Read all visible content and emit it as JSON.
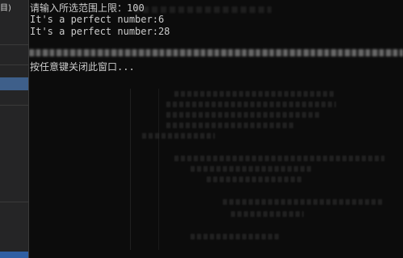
{
  "sidebar": {
    "label": "目)"
  },
  "console": {
    "lines": [
      "请输入所选范围上限：100",
      "It's a perfect number:6",
      "It's a perfect number:28"
    ],
    "exit_prompt": "按任意键关闭此窗口..."
  },
  "colors": {
    "console_background": "#0c0c0c",
    "console_text": "#cccccc",
    "sidebar_background": "#252526",
    "sidebar_selection": "#3e5f8a"
  }
}
